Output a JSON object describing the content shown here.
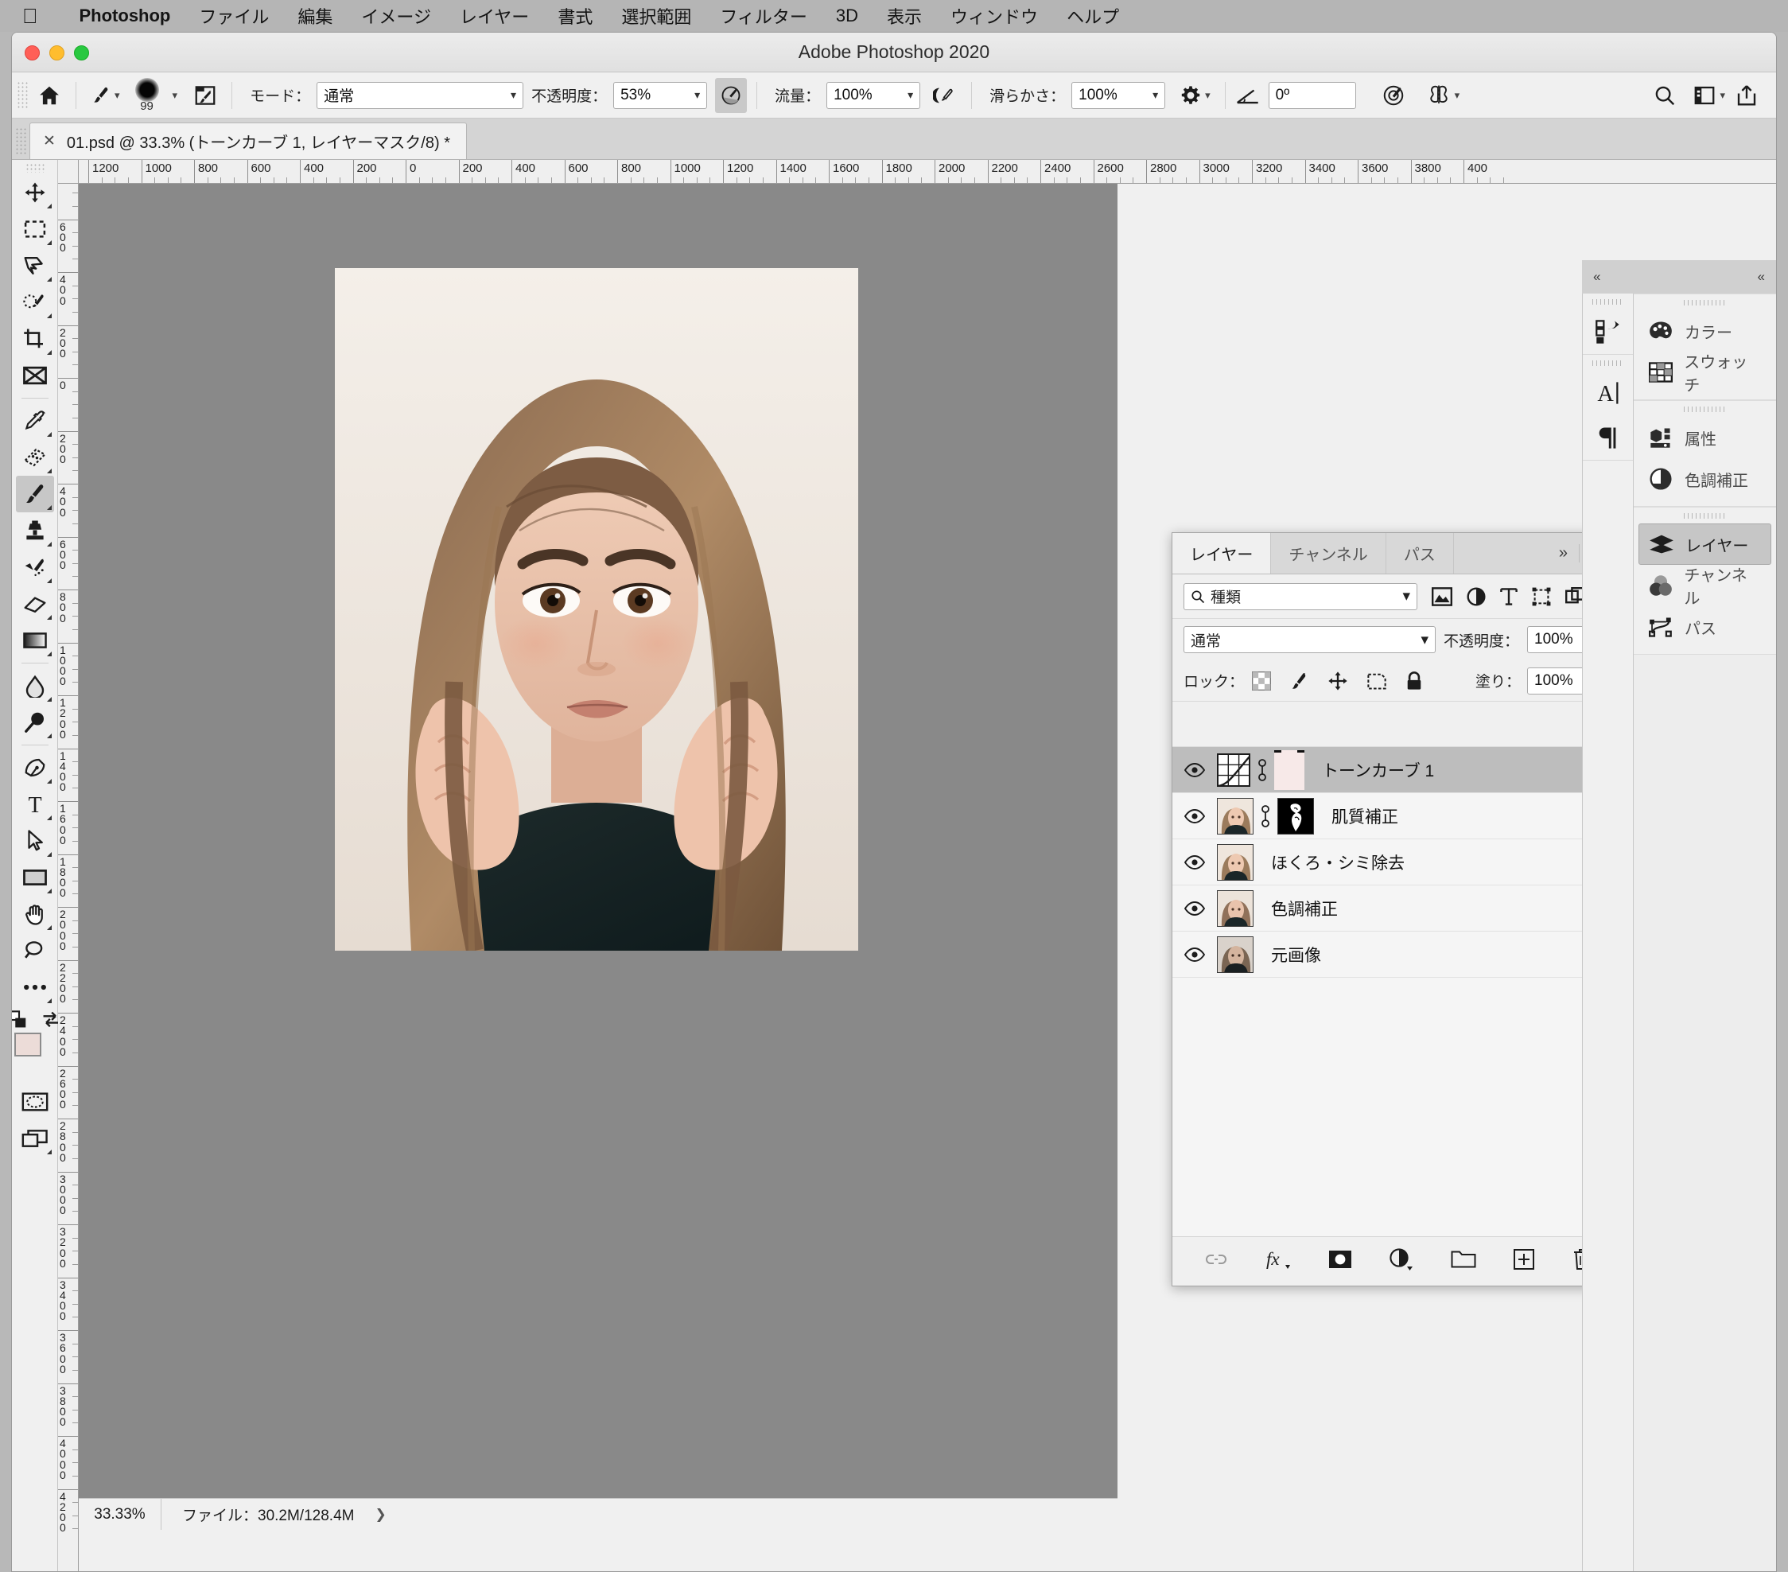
{
  "macmenu": {
    "apple_icon": "apple-logo-icon",
    "items": [
      {
        "label": "Photoshop",
        "bold": true
      },
      {
        "label": "ファイル",
        "bold": false
      },
      {
        "label": "編集",
        "bold": false
      },
      {
        "label": "イメージ",
        "bold": false
      },
      {
        "label": "レイヤー",
        "bold": false
      },
      {
        "label": "書式",
        "bold": false
      },
      {
        "label": "選択範囲",
        "bold": false
      },
      {
        "label": "フィルター",
        "bold": false
      },
      {
        "label": "3D",
        "bold": false
      },
      {
        "label": "表示",
        "bold": false
      },
      {
        "label": "ウィンドウ",
        "bold": false
      },
      {
        "label": "ヘルプ",
        "bold": false
      }
    ]
  },
  "window": {
    "title": "Adobe Photoshop 2020"
  },
  "options_bar": {
    "home_icon": "home-icon",
    "brush_preset_icon": "brush-icon",
    "brush_size": "99",
    "brush_settings_icon": "brush-panel-icon",
    "mode_label": "モード：",
    "mode_value": "通常",
    "opacity_label": "不透明度：",
    "opacity_value": "53%",
    "pressure_opacity_icon": "pressure-opacity-icon",
    "flow_label": "流量：",
    "flow_value": "100%",
    "airbrush_icon": "airbrush-icon",
    "smoothing_label": "滑らかさ：",
    "smoothing_value": "100%",
    "smoothing_gear_icon": "gear-icon",
    "angle_icon": "angle-icon",
    "angle_value": "0º",
    "pressure_size_icon": "pressure-size-icon",
    "symmetry_icon": "symmetry-butterfly-icon",
    "search_icon": "search-icon",
    "workspace_icon": "workspace-icon",
    "share_icon": "share-icon"
  },
  "document_tab": {
    "close_icon": "close-icon",
    "title": "01.psd @ 33.3% (トーンカーブ 1, レイヤーマスク/8) *"
  },
  "toolbox": [
    {
      "name": "move-tool",
      "icon": "move-icon",
      "selected": false,
      "has_flyout": true
    },
    {
      "name": "marquee-tool",
      "icon": "rect-marquee-icon",
      "selected": false,
      "has_flyout": true
    },
    {
      "name": "lasso-tool",
      "icon": "lasso-icon",
      "selected": false,
      "has_flyout": true
    },
    {
      "name": "object-selection-tool",
      "icon": "quick-selection-icon",
      "selected": false,
      "has_flyout": true
    },
    {
      "name": "crop-tool",
      "icon": "crop-icon",
      "selected": false,
      "has_flyout": true
    },
    {
      "name": "frame-tool",
      "icon": "frame-icon",
      "selected": false,
      "has_flyout": false
    },
    {
      "name": "eyedropper-tool",
      "icon": "eyedropper-icon",
      "selected": false,
      "has_flyout": true
    },
    {
      "name": "healing-brush-tool",
      "icon": "healing-brush-icon",
      "selected": false,
      "has_flyout": true
    },
    {
      "name": "brush-tool",
      "icon": "brush-icon",
      "selected": true,
      "has_flyout": true
    },
    {
      "name": "clone-stamp-tool",
      "icon": "clone-stamp-icon",
      "selected": false,
      "has_flyout": true
    },
    {
      "name": "history-brush-tool",
      "icon": "history-brush-icon",
      "selected": false,
      "has_flyout": true
    },
    {
      "name": "eraser-tool",
      "icon": "eraser-icon",
      "selected": false,
      "has_flyout": true
    },
    {
      "name": "gradient-tool",
      "icon": "gradient-icon",
      "selected": false,
      "has_flyout": true
    },
    {
      "name": "blur-tool",
      "icon": "blur-drop-icon",
      "selected": false,
      "has_flyout": true
    },
    {
      "name": "dodge-tool",
      "icon": "dodge-icon",
      "selected": false,
      "has_flyout": true
    },
    {
      "name": "pen-tool",
      "icon": "pen-icon",
      "selected": false,
      "has_flyout": true
    },
    {
      "name": "type-tool",
      "icon": "type-icon",
      "selected": false,
      "has_flyout": true
    },
    {
      "name": "path-selection-tool",
      "icon": "path-selection-arrow-icon",
      "selected": false,
      "has_flyout": true
    },
    {
      "name": "shape-tool",
      "icon": "rectangle-shape-icon",
      "selected": false,
      "has_flyout": true
    },
    {
      "name": "hand-tool",
      "icon": "hand-icon",
      "selected": false,
      "has_flyout": true
    },
    {
      "name": "zoom-tool",
      "icon": "magnifier-icon",
      "selected": false,
      "has_flyout": false
    },
    {
      "name": "edit-toolbar",
      "icon": "ellipsis-icon",
      "selected": false,
      "has_flyout": true
    }
  ],
  "toolbox_footer": {
    "default_colors_icon": "default-colors-icon",
    "swap_colors_icon": "swap-colors-icon",
    "foreground_color": "#ecdcd8",
    "background_color": "#111111",
    "quickmask_icon": "quick-mask-icon",
    "screenmode_icon": "screen-mode-icon"
  },
  "rulers": {
    "horizontal": [
      "1200",
      "1000",
      "800",
      "600",
      "400",
      "200",
      "0",
      "200",
      "400",
      "600",
      "800",
      "1000",
      "1200",
      "1400",
      "1600",
      "1800",
      "2000",
      "2200",
      "2400",
      "2600",
      "2800",
      "3000",
      "3200",
      "3400",
      "3600",
      "3800",
      "400"
    ],
    "vertical": [
      "0",
      "600",
      "400",
      "200",
      "0",
      "200",
      "400",
      "600",
      "800",
      "1000",
      "1200",
      "1400",
      "1600",
      "1800",
      "2000",
      "2200",
      "2400",
      "2600",
      "2800",
      "3000",
      "3200",
      "3400",
      "3600",
      "3800",
      "4000",
      "4200"
    ]
  },
  "status_bar": {
    "zoom": "33.33%",
    "file_info": "ファイル：30.2M/128.4M",
    "expand_icon": "chevron-right-icon"
  },
  "layers_panel": {
    "tabs": [
      {
        "label": "レイヤー",
        "active": true
      },
      {
        "label": "チャンネル",
        "active": false
      },
      {
        "label": "パス",
        "active": false
      }
    ],
    "overflow_icon": "double-chevron-icon",
    "menu_icon": "hamburger-menu-icon",
    "filter": {
      "search_icon": "search-icon",
      "kind_value": "種類",
      "icons": [
        "pixel-filter-icon",
        "adjustment-filter-icon",
        "type-filter-icon",
        "shape-filter-icon",
        "smartobject-filter-icon"
      ],
      "toggle_name": "filter-enable-toggle"
    },
    "blend_mode_label": "",
    "blend_mode_value": "通常",
    "opacity_label": "不透明度：",
    "opacity_value": "100%",
    "lock_label": "ロック：",
    "lock_icons": [
      "lock-transparent-pixels-icon",
      "lock-image-pixels-icon",
      "lock-position-icon",
      "lock-artboard-icon",
      "lock-all-icon"
    ],
    "fill_label": "塗り：",
    "fill_value": "100%",
    "rows": [
      {
        "name": "トーンカーブ 1",
        "selected": true,
        "visible": true,
        "thumb": "curves-adjustment-thumb",
        "has_link": true,
        "mask": "solid-pink-mask"
      },
      {
        "name": "肌質補正",
        "selected": false,
        "visible": true,
        "thumb": "portrait-thumb",
        "has_link": true,
        "mask": "black-layer-mask"
      },
      {
        "name": "ほくろ・シミ除去",
        "selected": false,
        "visible": true,
        "thumb": "portrait-thumb",
        "has_link": false,
        "mask": null
      },
      {
        "name": "色調補正",
        "selected": false,
        "visible": true,
        "thumb": "portrait-thumb",
        "has_link": false,
        "mask": null
      },
      {
        "name": "元画像",
        "selected": false,
        "visible": true,
        "thumb": "portrait-thumb",
        "has_link": false,
        "mask": null
      }
    ],
    "footer_icons": [
      {
        "name": "link-layers-icon",
        "label": ""
      },
      {
        "name": "layer-style-fx-icon",
        "label": "fx"
      },
      {
        "name": "add-layer-mask-icon",
        "label": ""
      },
      {
        "name": "new-adjustment-layer-icon",
        "label": ""
      },
      {
        "name": "new-group-icon",
        "label": ""
      },
      {
        "name": "new-layer-icon",
        "label": ""
      },
      {
        "name": "delete-layer-icon",
        "label": ""
      }
    ]
  },
  "icon_dock": {
    "collapse_icon": "double-chevron-left-icon",
    "items": [
      {
        "name": "history-panel-icon"
      },
      {
        "name": "character-panel-icon"
      },
      {
        "name": "paragraph-panel-icon"
      }
    ]
  },
  "right_dock": {
    "collapse_icon": "double-chevron-left-icon",
    "groups": [
      {
        "items": [
          {
            "label": "カラー",
            "icon": "color-palette-icon",
            "active": false
          },
          {
            "label": "スウォッチ",
            "icon": "swatches-grid-icon",
            "active": false
          }
        ]
      },
      {
        "items": [
          {
            "label": "属性",
            "icon": "properties-icon",
            "active": false
          },
          {
            "label": "色調補正",
            "icon": "adjustments-halfcircle-icon",
            "active": false
          }
        ]
      },
      {
        "items": [
          {
            "label": "レイヤー",
            "icon": "layers-stack-icon",
            "active": true
          },
          {
            "label": "チャンネル",
            "icon": "channels-venn-icon",
            "active": false
          },
          {
            "label": "パス",
            "icon": "paths-bezier-icon",
            "active": false
          }
        ]
      }
    ]
  },
  "colors": {
    "accent_selected_row": "#bdbdbd",
    "panel_bg": "#f0f0f0",
    "canvas_bg": "#898989",
    "app_chrome": "#b5b5b5"
  }
}
